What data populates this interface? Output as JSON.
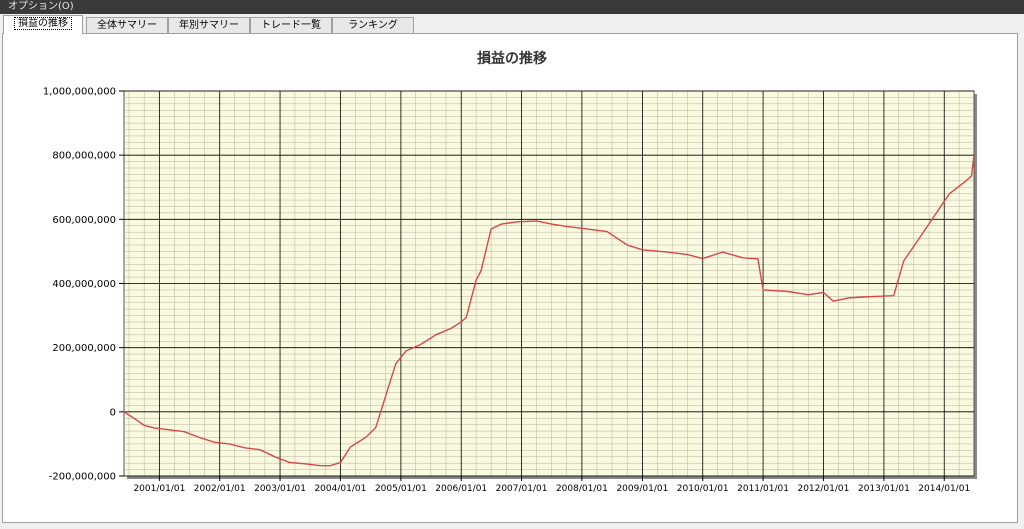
{
  "menubar": {
    "label": "オプション(O)"
  },
  "tabs": [
    {
      "label": "損益の推移",
      "active": true
    },
    {
      "label": "全体サマリー",
      "active": false
    },
    {
      "label": "年別サマリー",
      "active": false
    },
    {
      "label": "トレード一覧",
      "active": false
    },
    {
      "label": "ランキング",
      "active": false
    }
  ],
  "colors": {
    "plot_background": "#fafae0",
    "series_line": "#d84848",
    "grid_major": "#000000",
    "grid_minor": "#b4b4a0"
  },
  "chart_data": {
    "type": "line",
    "title": "損益の推移",
    "xlabel": "",
    "ylabel": "",
    "ylim": [
      -200000000,
      1000000000
    ],
    "xlim": [
      "2000-06-01",
      "2014-06-30"
    ],
    "y_ticks": [
      "1,000,000,000",
      "800,000,000",
      "600,000,000",
      "400,000,000",
      "200,000,000",
      "0",
      "-200,000,000"
    ],
    "x_ticks": [
      "2001/01/01",
      "2002/01/01",
      "2003/01/01",
      "2004/01/01",
      "2005/01/01",
      "2006/01/01",
      "2007/01/01",
      "2008/01/01",
      "2009/01/01",
      "2010/01/01",
      "2011/01/01",
      "2012/01/01",
      "2013/01/01",
      "2014/01/01"
    ],
    "grid": true,
    "legend": "none",
    "series": [
      {
        "x": [
          "2000-06-01",
          "2000-08-01",
          "2000-10-01",
          "2000-12-01",
          "2001-03-01",
          "2001-06-01",
          "2001-09-01",
          "2001-12-01",
          "2002-03-01",
          "2002-06-01",
          "2002-09-01",
          "2002-12-01",
          "2003-03-01",
          "2003-06-01",
          "2003-09-01",
          "2003-11-01",
          "2004-01-01",
          "2004-03-01",
          "2004-06-01",
          "2004-08-01",
          "2004-10-01",
          "2004-12-01",
          "2005-02-01",
          "2005-05-01",
          "2005-08-01",
          "2005-11-01",
          "2006-01-01",
          "2006-02-01",
          "2006-04-01",
          "2006-05-01",
          "2006-07-01",
          "2006-09-01",
          "2006-12-01",
          "2007-04-01",
          "2007-07-01",
          "2007-10-01",
          "2008-01-01",
          "2008-06-01",
          "2008-10-01",
          "2009-01-01",
          "2009-06-01",
          "2009-10-01",
          "2010-01-01",
          "2010-05-01",
          "2010-09-01",
          "2010-12-01",
          "2011-01-01",
          "2011-06-01",
          "2011-10-01",
          "2012-01-01",
          "2012-03-01",
          "2012-06-01",
          "2012-09-01",
          "2012-12-01",
          "2013-03-01",
          "2013-05-01",
          "2013-08-01",
          "2013-11-01",
          "2014-02-01",
          "2014-05-01",
          "2014-06-15",
          "2014-06-30"
        ],
        "y": [
          0,
          -20000000,
          -42000000,
          -50000000,
          -56000000,
          -62000000,
          -80000000,
          -95000000,
          -100000000,
          -112000000,
          -118000000,
          -140000000,
          -158000000,
          -162000000,
          -168000000,
          -168000000,
          -158000000,
          -110000000,
          -80000000,
          -50000000,
          50000000,
          150000000,
          190000000,
          210000000,
          240000000,
          260000000,
          280000000,
          295000000,
          410000000,
          440000000,
          570000000,
          585000000,
          592000000,
          595000000,
          585000000,
          578000000,
          572000000,
          562000000,
          520000000,
          505000000,
          498000000,
          490000000,
          478000000,
          498000000,
          480000000,
          477000000,
          380000000,
          375000000,
          365000000,
          372000000,
          345000000,
          355000000,
          358000000,
          360000000,
          362000000,
          470000000,
          540000000,
          610000000,
          680000000,
          715000000,
          735000000,
          800000000
        ]
      }
    ]
  }
}
